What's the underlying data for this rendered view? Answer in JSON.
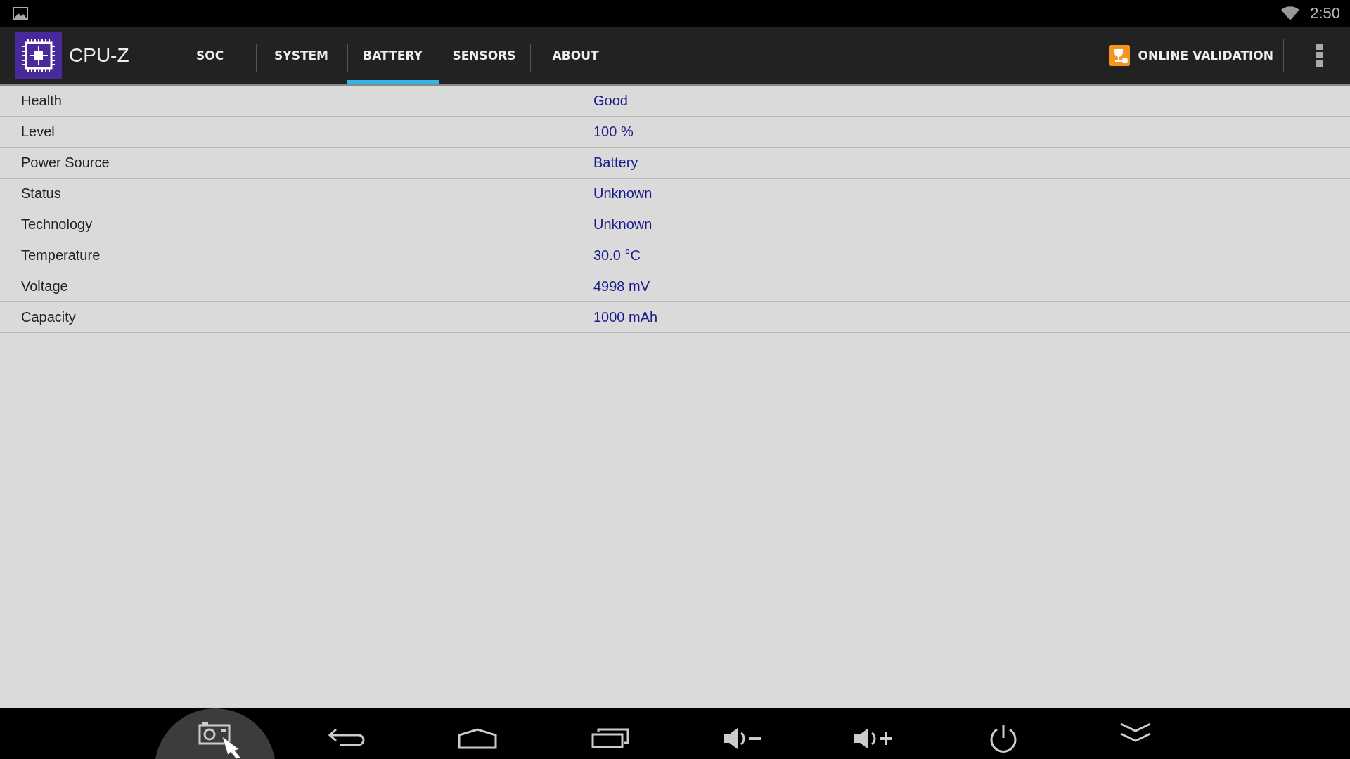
{
  "status_bar": {
    "time": "2:50"
  },
  "app_bar": {
    "title": "CPU-Z",
    "action": "ONLINE VALIDATION"
  },
  "tabs": [
    {
      "label": "SOC",
      "selected": false
    },
    {
      "label": "SYSTEM",
      "selected": false
    },
    {
      "label": "BATTERY",
      "selected": true
    },
    {
      "label": "SENSORS",
      "selected": false
    },
    {
      "label": "ABOUT",
      "selected": false
    }
  ],
  "rows": [
    {
      "label": "Health",
      "value": "Good"
    },
    {
      "label": "Level",
      "value": "100 %"
    },
    {
      "label": "Power Source",
      "value": "Battery"
    },
    {
      "label": "Status",
      "value": "Unknown"
    },
    {
      "label": "Technology",
      "value": "Unknown"
    },
    {
      "label": "Temperature",
      "value": "30.0 °C"
    },
    {
      "label": "Voltage",
      "value": "4998 mV"
    },
    {
      "label": "Capacity",
      "value": "1000 mAh"
    }
  ]
}
